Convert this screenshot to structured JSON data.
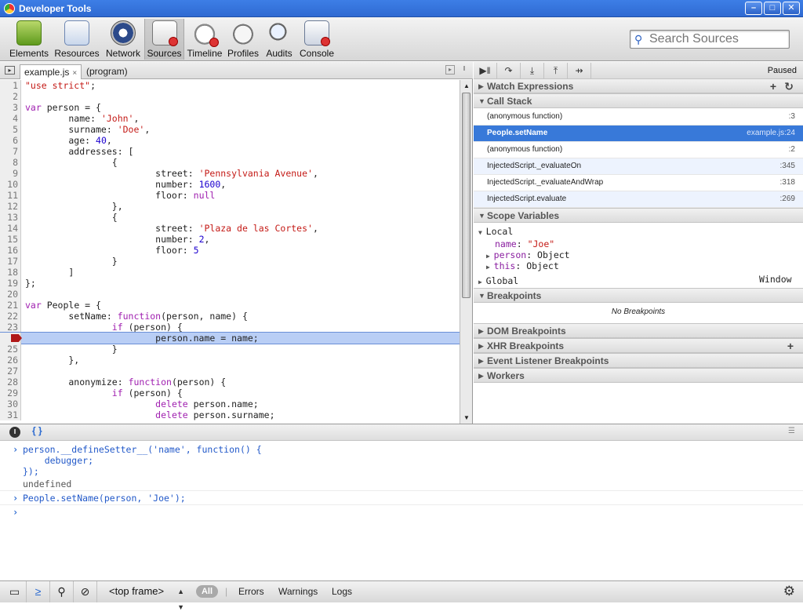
{
  "window": {
    "title": "Developer Tools"
  },
  "toolbar": {
    "tabs": [
      {
        "label": "Elements"
      },
      {
        "label": "Resources"
      },
      {
        "label": "Network"
      },
      {
        "label": "Sources"
      },
      {
        "label": "Timeline"
      },
      {
        "label": "Profiles"
      },
      {
        "label": "Audits"
      },
      {
        "label": "Console"
      }
    ],
    "search_placeholder": "Search Sources"
  },
  "editor": {
    "tabs": [
      {
        "label": "example.js"
      },
      {
        "label": "(program)"
      }
    ],
    "close_glyph": "×",
    "lines": [
      {
        "n": "1",
        "t": "\"use strict\";"
      },
      {
        "n": "2",
        "t": ""
      },
      {
        "n": "3",
        "t": "var person = {"
      },
      {
        "n": "4",
        "t": "        name: 'John',"
      },
      {
        "n": "5",
        "t": "        surname: 'Doe',"
      },
      {
        "n": "6",
        "t": "        age: 40,"
      },
      {
        "n": "7",
        "t": "        addresses: ["
      },
      {
        "n": "8",
        "t": "                {"
      },
      {
        "n": "9",
        "t": "                        street: 'Pennsylvania Avenue',"
      },
      {
        "n": "10",
        "t": "                        number: 1600,"
      },
      {
        "n": "11",
        "t": "                        floor: null"
      },
      {
        "n": "12",
        "t": "                },"
      },
      {
        "n": "13",
        "t": "                {"
      },
      {
        "n": "14",
        "t": "                        street: 'Plaza de las Cortes',"
      },
      {
        "n": "15",
        "t": "                        number: 2,"
      },
      {
        "n": "16",
        "t": "                        floor: 5"
      },
      {
        "n": "17",
        "t": "                }"
      },
      {
        "n": "18",
        "t": "        ]"
      },
      {
        "n": "19",
        "t": "};"
      },
      {
        "n": "20",
        "t": ""
      },
      {
        "n": "21",
        "t": "var People = {"
      },
      {
        "n": "22",
        "t": "        setName: function(person, name) {"
      },
      {
        "n": "23",
        "t": "                if (person) {"
      },
      {
        "n": "24",
        "t": "                        person.name = name;"
      },
      {
        "n": "25",
        "t": "                }"
      },
      {
        "n": "26",
        "t": "        },"
      },
      {
        "n": "27",
        "t": ""
      },
      {
        "n": "28",
        "t": "        anonymize: function(person) {"
      },
      {
        "n": "29",
        "t": "                if (person) {"
      },
      {
        "n": "30",
        "t": "                        delete person.name;"
      },
      {
        "n": "31",
        "t": "                        delete person.surname;"
      }
    ],
    "execution_line": "24",
    "breakpoint_line": "24"
  },
  "debugger": {
    "status": "Paused",
    "sections": {
      "watch": "Watch Expressions",
      "callstack": "Call Stack",
      "scope": "Scope Variables",
      "breakpoints": "Breakpoints",
      "dom": "DOM Breakpoints",
      "xhr": "XHR Breakpoints",
      "event": "Event Listener Breakpoints",
      "workers": "Workers"
    },
    "call_stack": [
      {
        "fn": "(anonymous function)",
        "loc": ":3"
      },
      {
        "fn": "People.setName",
        "loc": "example.js:24"
      },
      {
        "fn": "(anonymous function)",
        "loc": ":2"
      },
      {
        "fn": "InjectedScript._evaluateOn",
        "loc": ":345"
      },
      {
        "fn": "InjectedScript._evaluateAndWrap",
        "loc": ":318"
      },
      {
        "fn": "InjectedScript.evaluate",
        "loc": ":269"
      }
    ],
    "scope": {
      "local_label": "Local",
      "name_key": "name",
      "name_val": "\"Joe\"",
      "person_key": "person",
      "person_val": "Object",
      "this_key": "this",
      "this_val": "Object",
      "global_label": "Global",
      "global_val": "Window"
    },
    "no_breakpoints": "No Breakpoints"
  },
  "console": {
    "entries": [
      "person.__defineSetter__('name', function() {",
      "    debugger;",
      "});",
      "undefined",
      "People.setName(person, 'Joe');"
    ],
    "pretty_print": "{ }"
  },
  "statusbar": {
    "frame": "<top frame>",
    "all": "All",
    "filters": [
      "Errors",
      "Warnings",
      "Logs"
    ]
  },
  "colors": {
    "accent": "#3879d9",
    "exec_line": "#b9cef5",
    "breakpoint": "#b01818"
  }
}
